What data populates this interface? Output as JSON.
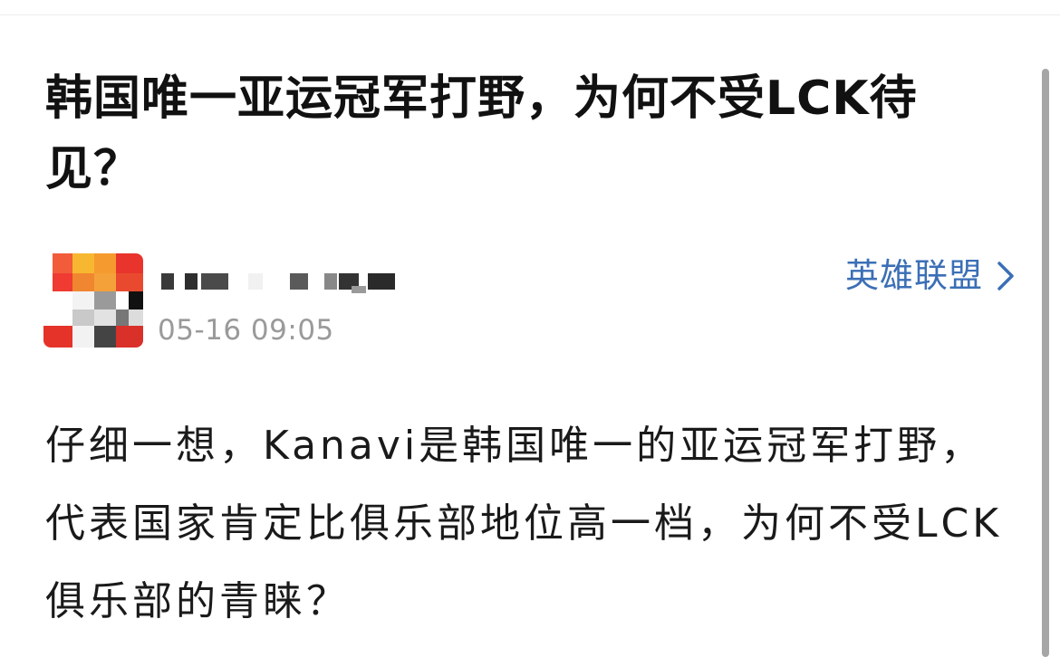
{
  "article": {
    "title": "韩国唯一亚运冠军打野，为何不受LCK待见？",
    "author": {
      "name": "",
      "timestamp": "05-16 09:05"
    },
    "category": {
      "label": "英雄联盟",
      "icon": "chevron-right-icon"
    },
    "body": "仔细一想，Kanavi是韩国唯一的亚运冠军打野，代表国家肯定比俱乐部地位高一档，为何不受LCK俱乐部的青睐？"
  },
  "colors": {
    "link": "#3b6fb6",
    "timestamp": "#9a9a9a",
    "text": "#1a1a1a"
  }
}
